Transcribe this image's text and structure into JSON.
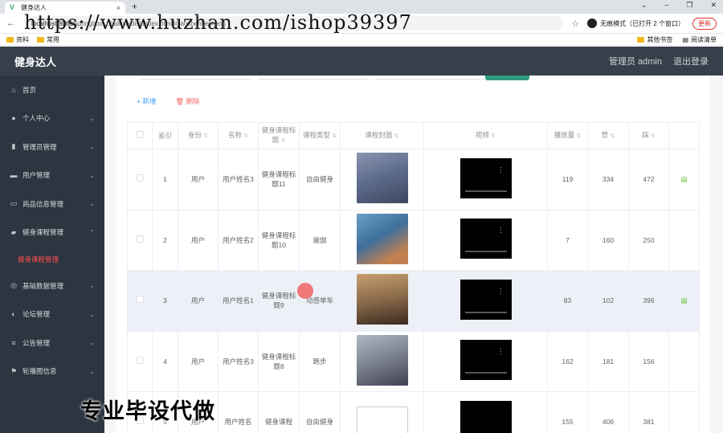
{
  "browser": {
    "tab_title": "健身达人",
    "url_prefix": "localhost:8080/",
    "url_rest": "springboot.../admin/dist/index.html#/jianshenkecheng",
    "incognito_label": "无痕模式（已打开 2 个窗口）",
    "update_label": "更新",
    "bookmarks": [
      "资料",
      "常用"
    ],
    "bookmarks_right": [
      "其他书签",
      "阅读清单"
    ]
  },
  "watermark": "https://www.huzhan.com/ishop39397",
  "header": {
    "brand": "健身达人",
    "admin_label": "管理员 admin",
    "logout_label": "退出登录"
  },
  "sidebar": {
    "items": [
      {
        "label": "首页",
        "icon": "home-icon",
        "glyph": "⌂"
      },
      {
        "label": "个人中心",
        "icon": "user-icon",
        "glyph": "●"
      },
      {
        "label": "管理员管理",
        "icon": "chart-icon",
        "glyph": "▮"
      },
      {
        "label": "用户管理",
        "icon": "idcard-icon",
        "glyph": "▬"
      },
      {
        "label": "商品信息管理",
        "icon": "message-icon",
        "glyph": "▭"
      },
      {
        "label": "健身课程管理",
        "icon": "briefcase-icon",
        "glyph": "▰"
      },
      {
        "label": "基础数据管理",
        "icon": "settings-icon",
        "glyph": "◎"
      },
      {
        "label": "论坛管理",
        "icon": "chat-icon",
        "glyph": "◐"
      },
      {
        "label": "公告管理",
        "icon": "list-icon",
        "glyph": "≡"
      },
      {
        "label": "轮播图信息",
        "icon": "flag-icon",
        "glyph": "⚑"
      }
    ],
    "active_sub": "健身课程管理"
  },
  "actions": {
    "add_label": "+ 新增",
    "delete_label": "删除"
  },
  "table": {
    "headers": [
      "索引",
      "身份",
      "名称",
      "健身课程标题",
      "课程类型",
      "课程封面",
      "视频",
      "播放量",
      "赞",
      "踩"
    ],
    "rows": [
      {
        "index": "1",
        "role": "用户",
        "name": "用户姓名3",
        "title": "健身课程标题11",
        "type": "自由健身",
        "plays": "119",
        "likes": "334",
        "dislikes": "472",
        "cover_color": "#5c6a8a"
      },
      {
        "index": "2",
        "role": "用户",
        "name": "用户姓名2",
        "title": "健身课程标题10",
        "type": "瑜伽",
        "plays": "7",
        "likes": "160",
        "dislikes": "250",
        "cover_color": "#3f6f9b"
      },
      {
        "index": "3",
        "role": "用户",
        "name": "用户姓名1",
        "title": "健身课程标题9",
        "type": "动感单车",
        "plays": "83",
        "likes": "102",
        "dislikes": "396",
        "cover_color": "#8a6a4a"
      },
      {
        "index": "4",
        "role": "用户",
        "name": "用户姓名3",
        "title": "健身课程标题8",
        "type": "跑步",
        "plays": "162",
        "likes": "181",
        "dislikes": "156",
        "cover_color": "#7a8090"
      },
      {
        "index": "5",
        "role": "用户",
        "name": "用户姓名",
        "title": "健身课程",
        "type": "自由健身",
        "plays": "155",
        "likes": "406",
        "dislikes": "381",
        "cover_color": ""
      }
    ]
  },
  "overlay_text": "专业毕设代做"
}
